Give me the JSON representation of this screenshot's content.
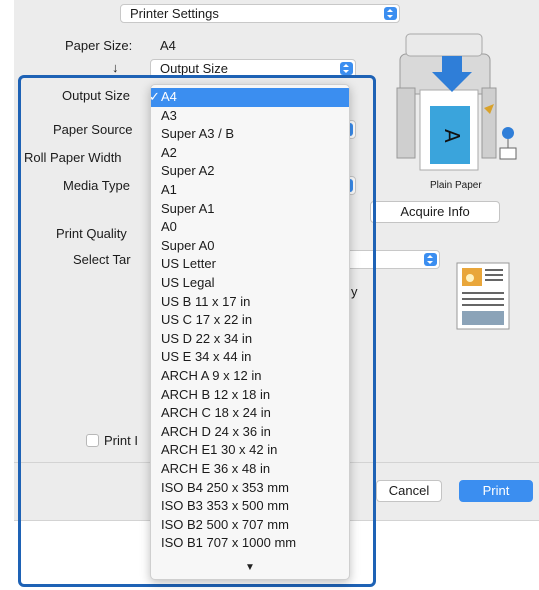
{
  "header": {
    "printer_settings_popup": "Printer Settings"
  },
  "paper_size": {
    "label": "Paper Size:",
    "value": "A4"
  },
  "output_size_row": {
    "arrow": "↓",
    "value": "Output Size"
  },
  "left_labels": {
    "output_size": "Output Size",
    "paper_source": "Paper Source",
    "roll_paper_width": "Roll Paper Width",
    "media_type": "Media Type",
    "print_quality": "Print Quality",
    "select_target": "Select Tar",
    "print_checkbox": "Print I"
  },
  "right_panel": {
    "media_caption": "Plain Paper",
    "acquire_info_button": "Acquire Info",
    "fragment_text": "y"
  },
  "dropdown": {
    "checkmark": "✓",
    "items": [
      "A4",
      "A3",
      "Super A3 / B",
      "A2",
      "Super A2",
      "A1",
      "Super A1",
      "A0",
      "Super A0",
      "US Letter",
      "US Legal",
      "US B 11 x 17 in",
      "US C 17 x 22 in",
      "US D 22 x 34 in",
      "US E 34 x 44 in",
      "ARCH A 9 x 12 in",
      "ARCH B 12 x 18 in",
      "ARCH C 18 x 24 in",
      "ARCH D 24 x 36 in",
      "ARCH E1 30 x 42 in",
      "ARCH E 36 x 48 in",
      "ISO B4 250 x 353 mm",
      "ISO B3 353 x 500 mm",
      "ISO B2 500 x 707 mm",
      "ISO B1 707 x 1000 mm"
    ],
    "selected_index": 0,
    "scroll_more": "▼"
  },
  "footer": {
    "cancel": "Cancel",
    "print": "Print"
  },
  "colors": {
    "accent": "#3b8ef0",
    "frame": "#1e62b5"
  }
}
